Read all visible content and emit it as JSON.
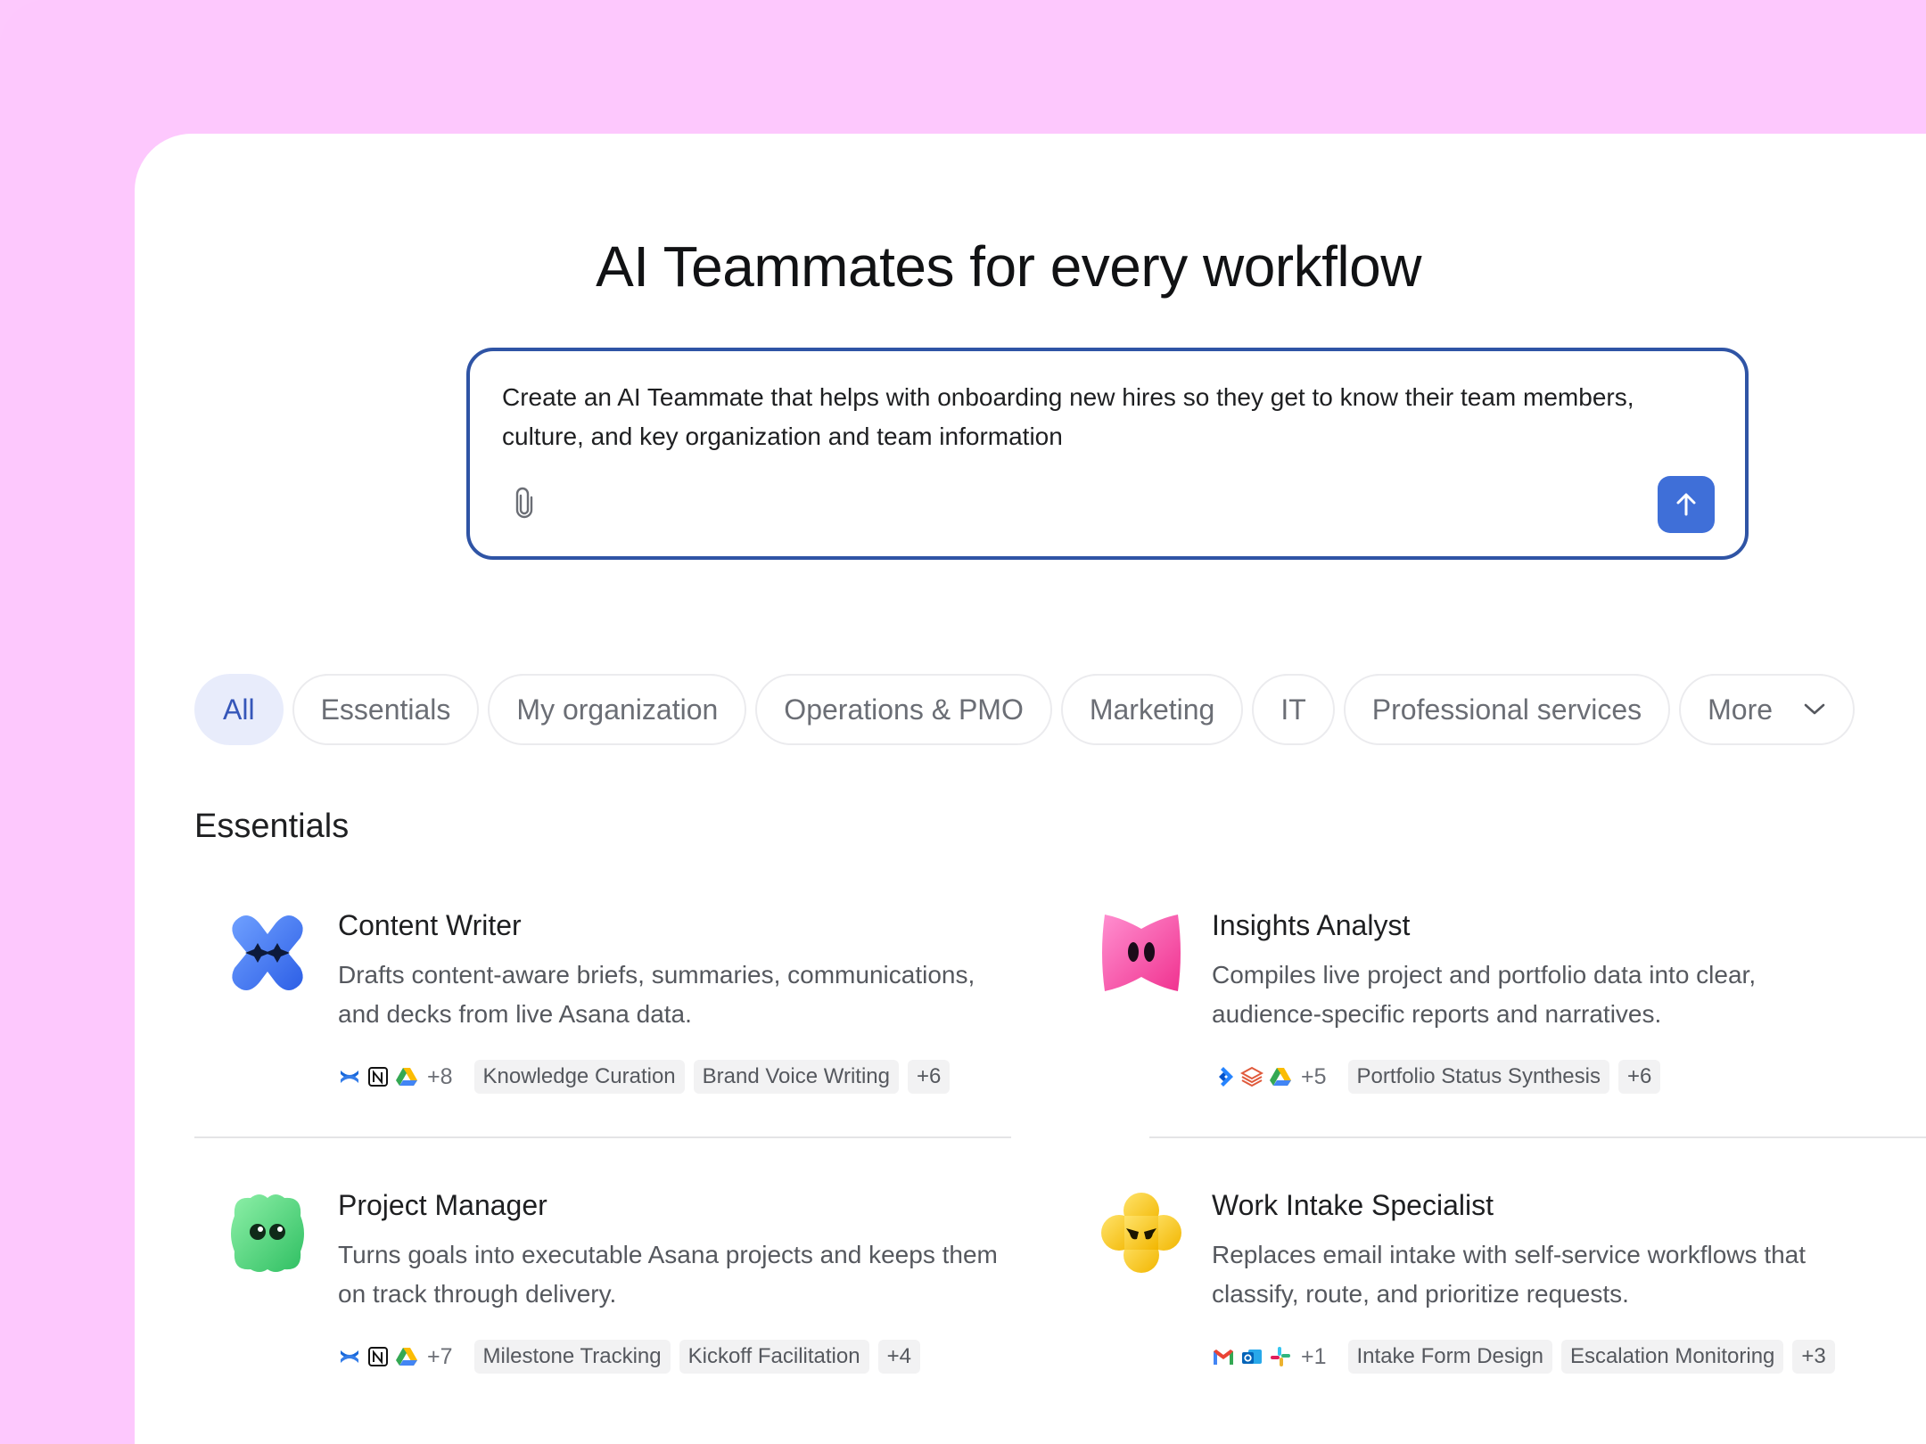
{
  "hero": {
    "title": "AI Teammates for every workflow"
  },
  "prompt": {
    "text": "Create an AI Teammate that helps with onboarding new hires so they get to know their team members, culture, and key organization and team information",
    "attach_icon": "paperclip-icon",
    "send_icon": "arrow-up-icon",
    "accent_color": "#3f6fd8",
    "border_color": "#2f54a5"
  },
  "filters": {
    "items": [
      "All",
      "Essentials",
      "My organization",
      "Operations & PMO",
      "Marketing",
      "IT",
      "Professional services"
    ],
    "more_label": "More",
    "active": "All"
  },
  "section": {
    "title": "Essentials"
  },
  "cards": [
    {
      "title": "Content Writer",
      "description": "Drafts content-aware briefs, summaries, communications, and decks from live Asana data.",
      "avatar": "blue-x-avatar",
      "apps": [
        "confluence-icon",
        "notion-icon",
        "google-drive-icon"
      ],
      "app_count": "+8",
      "tags": [
        "Knowledge Curation",
        "Brand Voice Writing"
      ],
      "tag_count": "+6"
    },
    {
      "title": "Insights Analyst",
      "description": "Compiles live project and portfolio data into clear, audience-specific reports and narratives.",
      "avatar": "pink-bow-avatar",
      "apps": [
        "jira-icon",
        "stack-icon",
        "google-drive-icon"
      ],
      "app_count": "+5",
      "tags": [
        "Portfolio Status Synthesis"
      ],
      "tag_count": "+6"
    },
    {
      "title": "Project Manager",
      "description": "Turns goals into executable Asana projects and keeps them on track through delivery.",
      "avatar": "green-blob-avatar",
      "apps": [
        "confluence-icon",
        "notion-icon",
        "google-drive-icon"
      ],
      "app_count": "+7",
      "tags": [
        "Milestone Tracking",
        "Kickoff Facilitation"
      ],
      "tag_count": "+4"
    },
    {
      "title": "Work Intake Specialist",
      "description": "Replaces email intake with self-service workflows that classify, route, and prioritize requests.",
      "avatar": "yellow-clover-avatar",
      "apps": [
        "gmail-icon",
        "outlook-icon",
        "slack-icon"
      ],
      "app_count": "+1",
      "tags": [
        "Intake Form Design",
        "Escalation Monitoring"
      ],
      "tag_count": "+3"
    }
  ]
}
